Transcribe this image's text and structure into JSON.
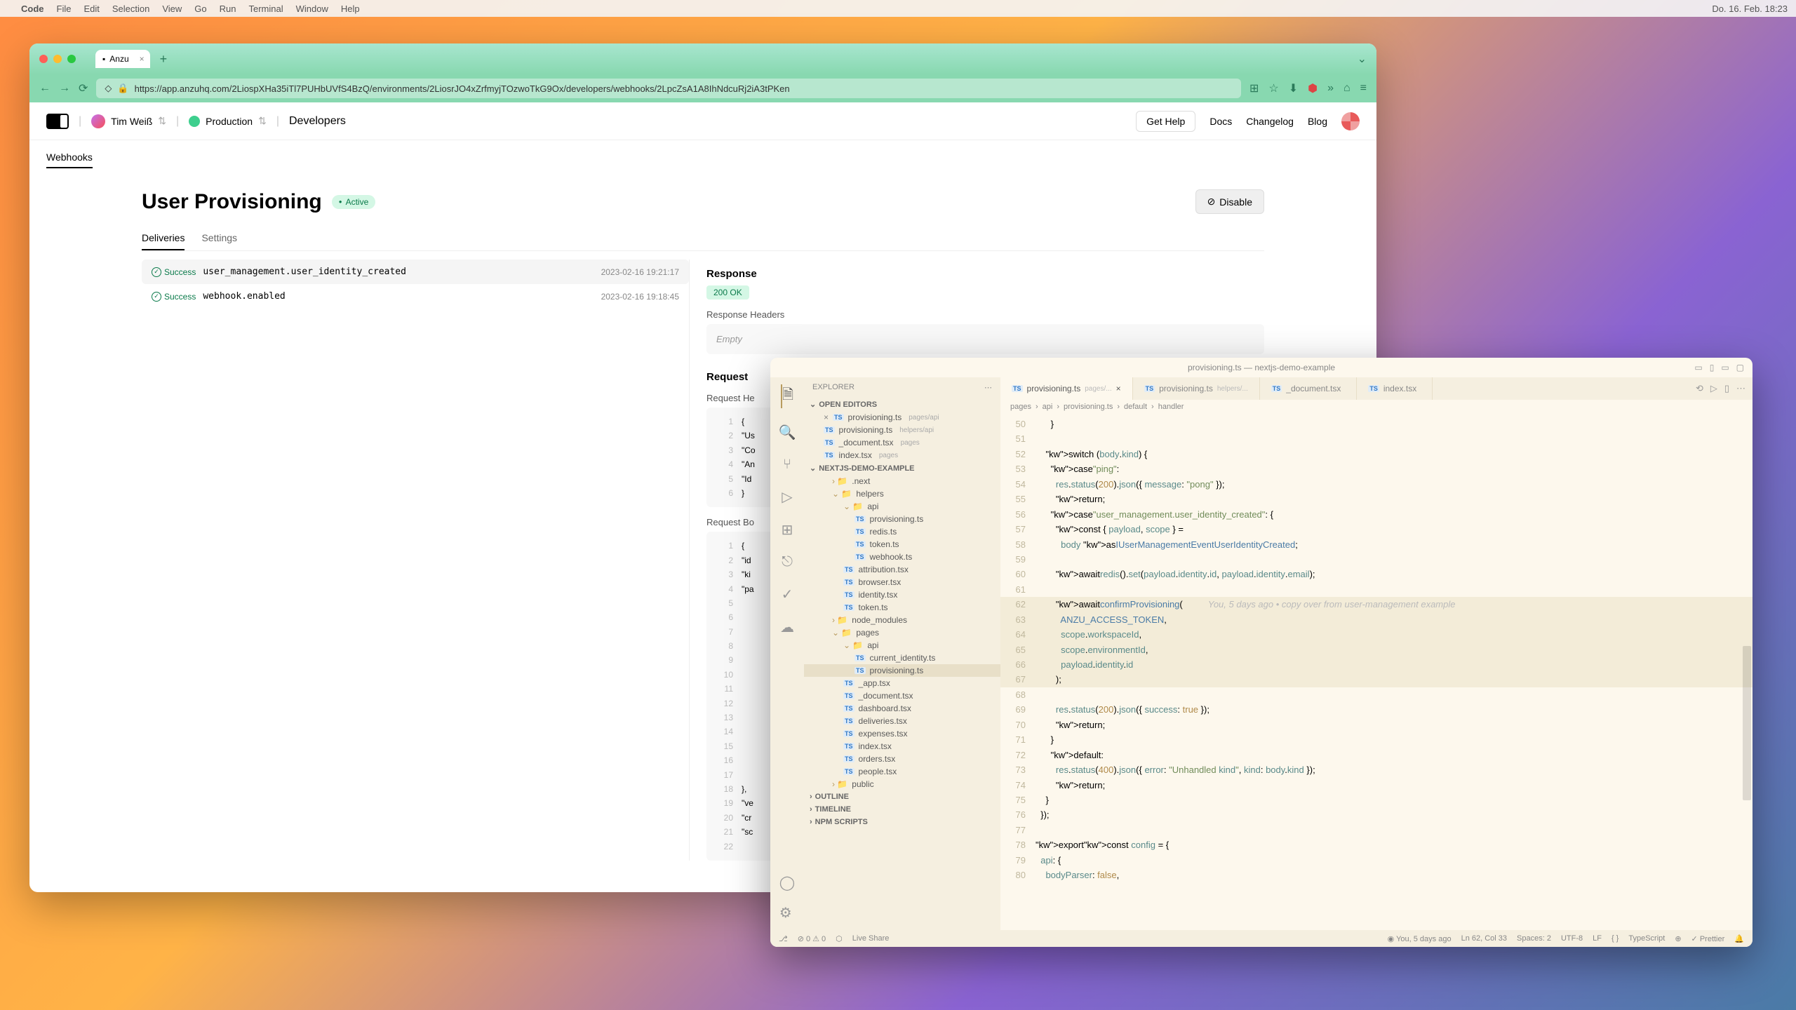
{
  "menubar": {
    "app": "Code",
    "items": [
      "File",
      "Edit",
      "Selection",
      "View",
      "Go",
      "Run",
      "Terminal",
      "Window",
      "Help"
    ],
    "date": "Do. 16. Feb. 18:23"
  },
  "browser": {
    "tab_title": "Anzu",
    "url": "https://app.anzuhq.com/2LiospXHa35iTl7PUHbUVfS4BzQ/environments/2LiosrJO4xZrfmyjTOzwoTkG9Ox/developers/webhooks/2LpcZsA1A8IhNdcuRj2iA3tPKen",
    "header": {
      "user": "Tim Weiß",
      "env": "Production",
      "section": "Developers",
      "get_help": "Get Help",
      "links": [
        "Docs",
        "Changelog",
        "Blog"
      ]
    },
    "subnav": "Webhooks",
    "page": {
      "title": "User Provisioning",
      "badge": "Active",
      "disable": "Disable",
      "tabs": [
        "Deliveries",
        "Settings"
      ],
      "deliveries": [
        {
          "status": "Success",
          "event": "user_management.user_identity_created",
          "time": "2023-02-16 19:21:17"
        },
        {
          "status": "Success",
          "event": "webhook.enabled",
          "time": "2023-02-16 19:18:45"
        }
      ],
      "response": {
        "title": "Response",
        "status": "200 OK",
        "headers_label": "Response Headers",
        "empty": "Empty"
      },
      "request": {
        "title": "Request",
        "headers_label": "Request He",
        "headers_lines": [
          "{",
          "\"Us",
          "\"Co",
          "\"An",
          "\"Id",
          "}"
        ],
        "body_label": "Request Bo",
        "body_lines": [
          "{",
          "\"id",
          "\"ki",
          "\"pa",
          "",
          "",
          "",
          "",
          "",
          "",
          "",
          "",
          "",
          "",
          "",
          "",
          "",
          "},",
          "\"ve",
          "\"cr",
          "\"sc",
          ""
        ]
      }
    }
  },
  "vscode": {
    "title": "provisioning.ts — nextjs-demo-example",
    "explorer_label": "EXPLORER",
    "sections": {
      "open_editors": "OPEN EDITORS",
      "project": "NEXTJS-DEMO-EXAMPLE",
      "outline": "OUTLINE",
      "timeline": "TIMELINE",
      "npm": "NPM SCRIPTS"
    },
    "open_editors": [
      {
        "name": "provisioning.ts",
        "path": "pages/api",
        "active": true
      },
      {
        "name": "provisioning.ts",
        "path": "helpers/api"
      },
      {
        "name": "_document.tsx",
        "path": "pages"
      },
      {
        "name": "index.tsx",
        "path": "pages"
      }
    ],
    "tree": [
      {
        "name": ".next",
        "type": "folder",
        "depth": 1
      },
      {
        "name": "helpers",
        "type": "folder",
        "depth": 1,
        "open": true
      },
      {
        "name": "api",
        "type": "folder",
        "depth": 2,
        "open": true
      },
      {
        "name": "provisioning.ts",
        "type": "ts",
        "depth": 3
      },
      {
        "name": "redis.ts",
        "type": "ts",
        "depth": 3
      },
      {
        "name": "token.ts",
        "type": "ts",
        "depth": 3
      },
      {
        "name": "webhook.ts",
        "type": "ts",
        "depth": 3
      },
      {
        "name": "attribution.tsx",
        "type": "ts",
        "depth": 2
      },
      {
        "name": "browser.tsx",
        "type": "ts",
        "depth": 2
      },
      {
        "name": "identity.tsx",
        "type": "ts",
        "depth": 2
      },
      {
        "name": "token.ts",
        "type": "ts",
        "depth": 2
      },
      {
        "name": "node_modules",
        "type": "folder",
        "depth": 1
      },
      {
        "name": "pages",
        "type": "folder",
        "depth": 1,
        "open": true
      },
      {
        "name": "api",
        "type": "folder",
        "depth": 2,
        "open": true
      },
      {
        "name": "current_identity.ts",
        "type": "ts",
        "depth": 3
      },
      {
        "name": "provisioning.ts",
        "type": "ts",
        "depth": 3,
        "selected": true
      },
      {
        "name": "_app.tsx",
        "type": "ts",
        "depth": 2
      },
      {
        "name": "_document.tsx",
        "type": "ts",
        "depth": 2
      },
      {
        "name": "dashboard.tsx",
        "type": "ts",
        "depth": 2
      },
      {
        "name": "deliveries.tsx",
        "type": "ts",
        "depth": 2
      },
      {
        "name": "expenses.tsx",
        "type": "ts",
        "depth": 2
      },
      {
        "name": "index.tsx",
        "type": "ts",
        "depth": 2
      },
      {
        "name": "orders.tsx",
        "type": "ts",
        "depth": 2
      },
      {
        "name": "people.tsx",
        "type": "ts",
        "depth": 2
      },
      {
        "name": "public",
        "type": "folder",
        "depth": 1
      }
    ],
    "editor_tabs": [
      {
        "name": "provisioning.ts",
        "path": "pages/...",
        "active": true
      },
      {
        "name": "provisioning.ts",
        "path": "helpers/..."
      },
      {
        "name": "_document.tsx",
        "path": ""
      },
      {
        "name": "index.tsx",
        "path": ""
      }
    ],
    "breadcrumb": [
      "pages",
      "api",
      "provisioning.ts",
      "default",
      "handler"
    ],
    "code_lines": [
      {
        "n": 50,
        "t": "      }"
      },
      {
        "n": 51,
        "t": ""
      },
      {
        "n": 52,
        "t": "    switch (body.kind) {"
      },
      {
        "n": 53,
        "t": "      case \"ping\":"
      },
      {
        "n": 54,
        "t": "        res.status(200).json({ message: \"pong\" });"
      },
      {
        "n": 55,
        "t": "        return;"
      },
      {
        "n": 56,
        "t": "      case \"user_management.user_identity_created\": {"
      },
      {
        "n": 57,
        "t": "        const { payload, scope } ="
      },
      {
        "n": 58,
        "t": "          body as IUserManagementEventUserIdentityCreated;"
      },
      {
        "n": 59,
        "t": ""
      },
      {
        "n": 60,
        "t": "        await redis().set(payload.identity.id, payload.identity.email);"
      },
      {
        "n": 61,
        "t": ""
      },
      {
        "n": 62,
        "t": "        await confirmProvisioning(",
        "hl": true,
        "blame": "You, 5 days ago • copy over from user-management example"
      },
      {
        "n": 63,
        "t": "          ANZU_ACCESS_TOKEN,",
        "hl": true
      },
      {
        "n": 64,
        "t": "          scope.workspaceId,",
        "hl": true
      },
      {
        "n": 65,
        "t": "          scope.environmentId,",
        "hl": true
      },
      {
        "n": 66,
        "t": "          payload.identity.id",
        "hl": true
      },
      {
        "n": 67,
        "t": "        );",
        "hl": true
      },
      {
        "n": 68,
        "t": ""
      },
      {
        "n": 69,
        "t": "        res.status(200).json({ success: true });"
      },
      {
        "n": 70,
        "t": "        return;"
      },
      {
        "n": 71,
        "t": "      }"
      },
      {
        "n": 72,
        "t": "      default:"
      },
      {
        "n": 73,
        "t": "        res.status(400).json({ error: \"Unhandled kind\", kind: body.kind });"
      },
      {
        "n": 74,
        "t": "        return;"
      },
      {
        "n": 75,
        "t": "    }"
      },
      {
        "n": 76,
        "t": "  });"
      },
      {
        "n": 77,
        "t": ""
      },
      {
        "n": 78,
        "t": "export const config = {"
      },
      {
        "n": 79,
        "t": "  api: {"
      },
      {
        "n": 80,
        "t": "    bodyParser: false,"
      }
    ],
    "statusbar": {
      "left": [
        "⎇",
        "⊘ 0 ⚠ 0",
        "⬡",
        "Live Share"
      ],
      "blame": "You, 5 days ago",
      "pos": "Ln 62, Col 33",
      "spaces": "Spaces: 2",
      "enc": "UTF-8",
      "eol": "LF",
      "lang": "TypeScript",
      "prettier": "Prettier"
    }
  }
}
